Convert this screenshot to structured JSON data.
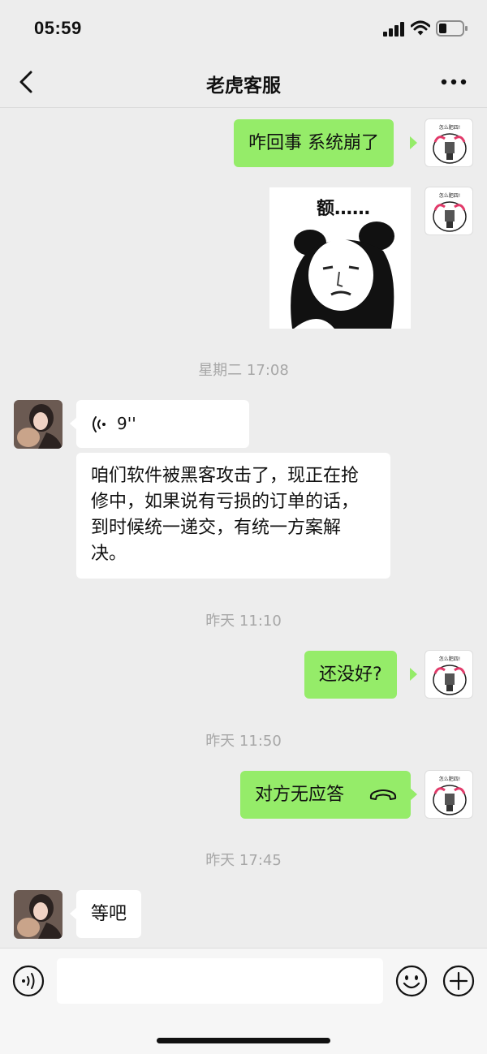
{
  "status_bar": {
    "time": "05:59",
    "battery_level": 0.35
  },
  "chat": {
    "title": "老虎客服"
  },
  "messages": {
    "m1": "咋回事 系统崩了",
    "sticker_caption": "额……",
    "ts1": "星期二 17:08",
    "voice_duration": "9''",
    "m3": "咱们软件被黑客攻击了，现正在抢修中，如果说有亏损的订单的话，到时候统一递交，有统一方案解决。",
    "ts2": "昨天 11:10",
    "m4": "还没好?",
    "ts3": "昨天 11:50",
    "m5": "对方无应答",
    "ts4": "昨天 17:45",
    "m6": "等吧"
  },
  "avatar_text": "怎么肥四!",
  "colors": {
    "background": "#ededed",
    "bubble_me": "#95ec69",
    "bubble_other": "#ffffff",
    "timestamp": "#a7a7a7"
  },
  "icons": {
    "back": "chevron-left-icon",
    "more": "more-dots-icon",
    "voice": "voice-wave-icon",
    "call": "hangup-phone-icon",
    "emoji": "smiley-icon",
    "plus": "plus-icon"
  }
}
